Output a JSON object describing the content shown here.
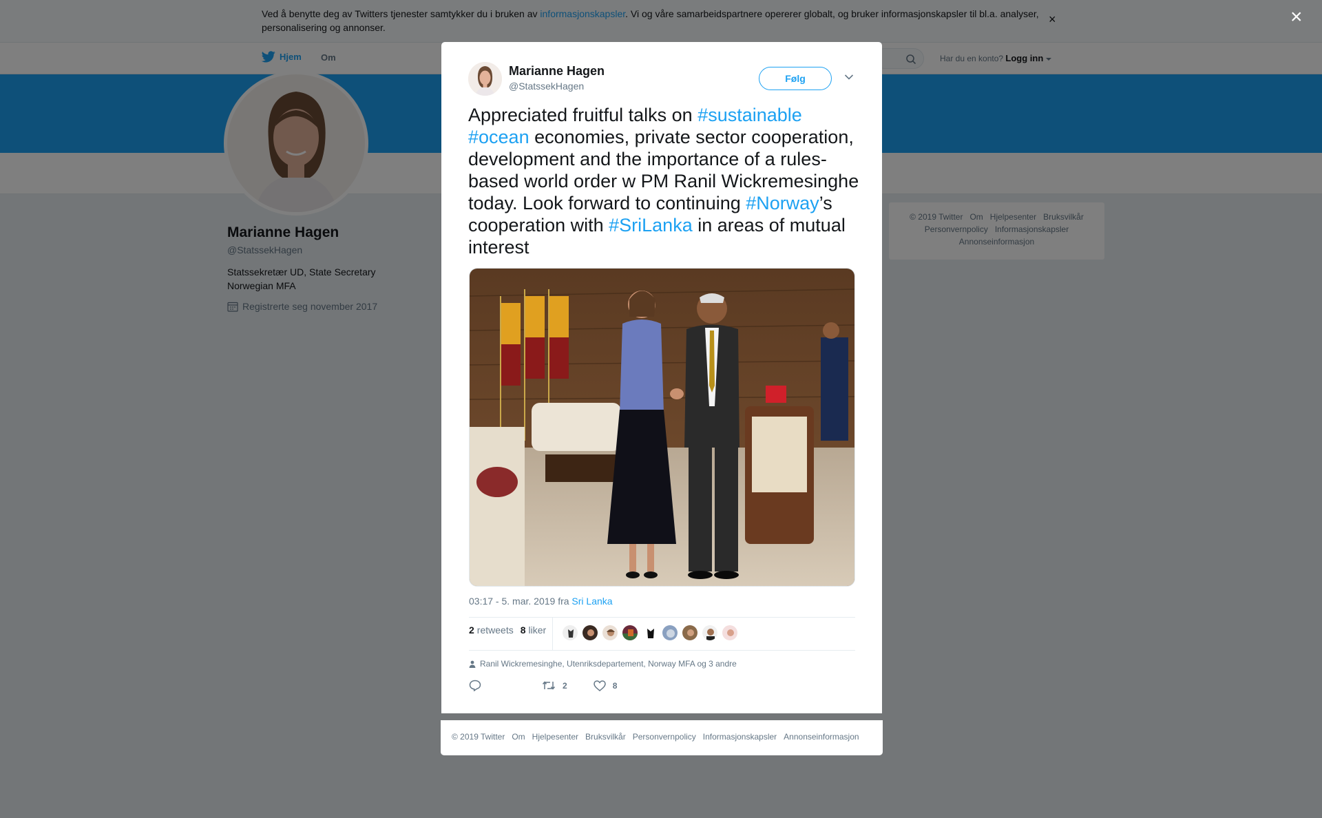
{
  "cookie_banner": {
    "text_before": "Ved å benytte deg av Twitters tjenester samtykker du i bruken av ",
    "link": "informasjonskapsler",
    "text_after": ". Vi og våre samarbeidspartnere opererer globalt, og bruker informasjonskapsler til bl.a. analyser, personalisering og annonser.",
    "close": "×"
  },
  "topnav": {
    "home": "Hjem",
    "about": "Om",
    "account_prompt": "Har du en konto?",
    "login": "Logg inn"
  },
  "profile": {
    "name": "Marianne Hagen",
    "handle": "@StatssekHagen",
    "bio": "Statssekretær UD, State Secretary Norwegian MFA",
    "joined": "Registrerte seg november 2017"
  },
  "side_footer": {
    "links": [
      "© 2019 Twitter",
      "Om",
      "Hjelpesenter",
      "Bruksvilkår",
      "Personvernpolicy",
      "Informasjonskapsler",
      "Annonseinformasjon"
    ]
  },
  "overlay_close": "×",
  "tweet": {
    "author_name": "Marianne Hagen",
    "author_handle": "@StatssekHagen",
    "follow_label": "Følg",
    "text_1": "Appreciated fruitful talks on ",
    "tag_1": "#sustainable",
    "text_sp": " ",
    "tag_2": "#ocean",
    "text_2": " economies, private sector cooperation, development and the importance of a rules-based world order w PM Ranil Wickremesinghe today. Look forward to continuing ",
    "tag_3": "#Norway",
    "text_3": "’s cooperation with ",
    "tag_4": "#SriLanka",
    "text_4": " in areas of mutual interest",
    "time": "03:17 - 5. mar. 2019 fra ",
    "location": "Sri Lanka",
    "retweets_count": "2",
    "retweets_label": "retweets",
    "likes_count": "8",
    "likes_label": "liker",
    "replying_to": "Ranil Wickremesinghe, Utenriksdepartement, Norway MFA og 3 andre",
    "action_retweet_count": "2",
    "action_like_count": "8"
  },
  "modal_footer": {
    "links": [
      "© 2019 Twitter",
      "Om",
      "Hjelpesenter",
      "Bruksvilkår",
      "Personvernpolicy",
      "Informasjonskapsler",
      "Annonseinformasjon"
    ]
  },
  "colors": {
    "accent": "#1da1f2",
    "text": "#14171a",
    "muted": "#657786"
  }
}
